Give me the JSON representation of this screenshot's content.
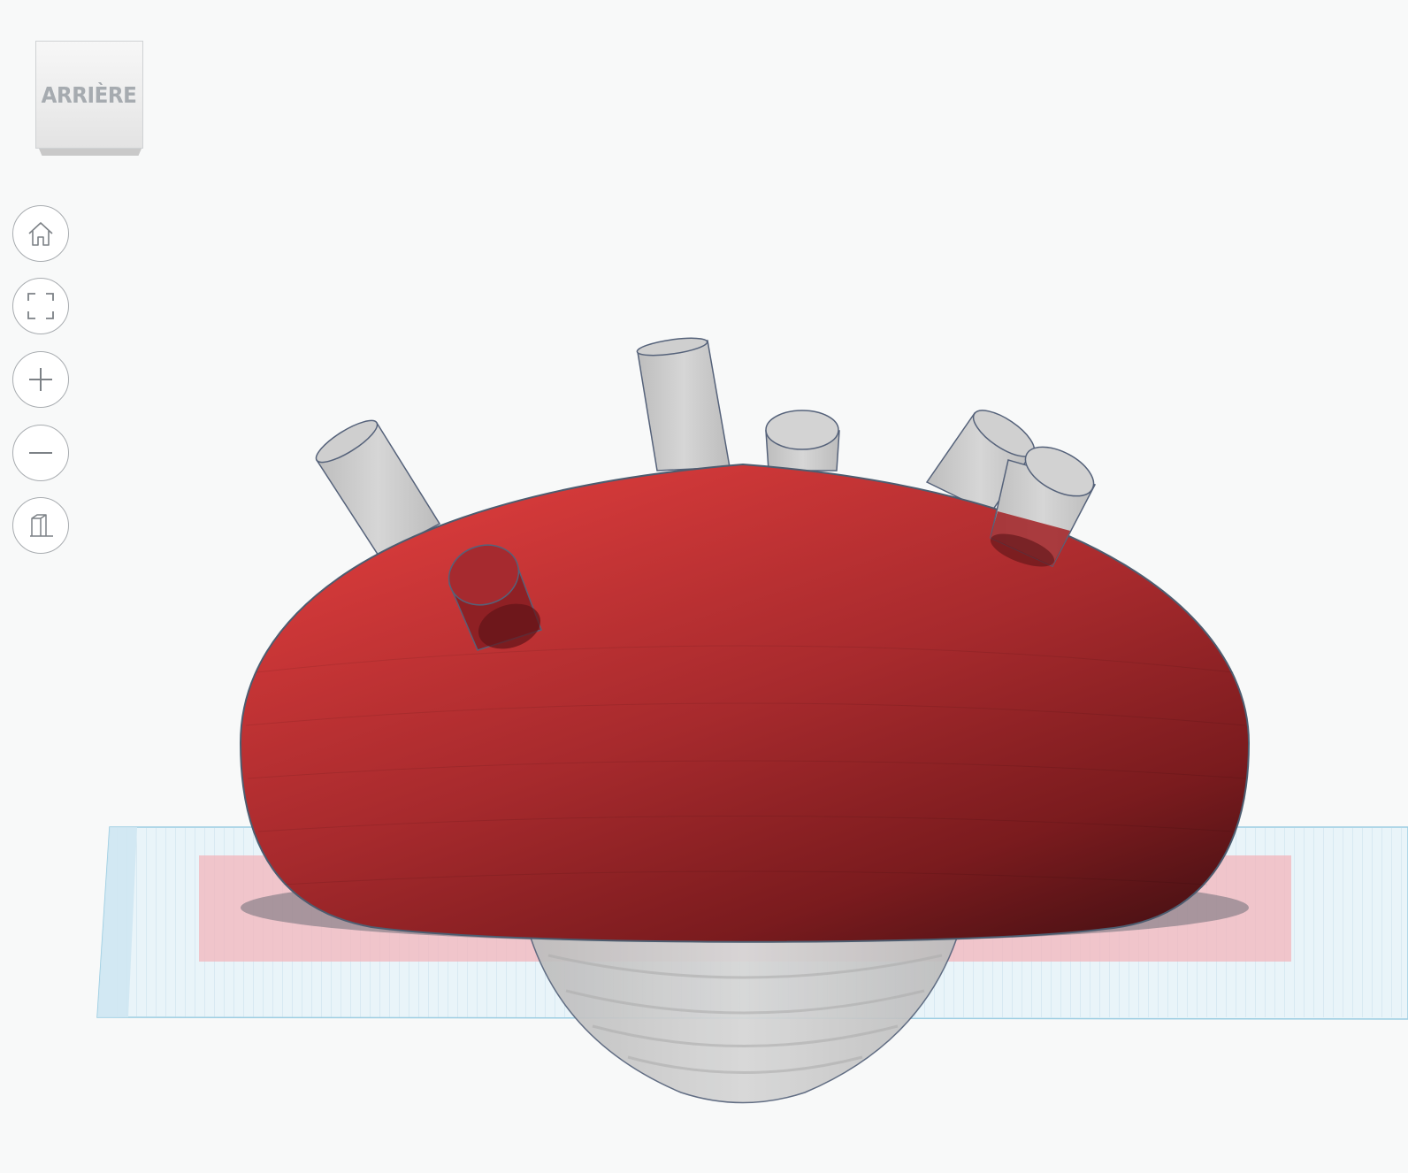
{
  "view_cube": {
    "face_label": "ARRIÈRE"
  },
  "nav_controls": [
    {
      "name": "home-view",
      "icon": "home-icon"
    },
    {
      "name": "fit-all",
      "icon": "fit-view-icon"
    },
    {
      "name": "zoom-in",
      "icon": "plus-icon"
    },
    {
      "name": "zoom-out",
      "icon": "minus-icon"
    },
    {
      "name": "perspective-toggle",
      "icon": "perspective-cube-icon"
    }
  ],
  "scene": {
    "main_shape_color": "#c8262c",
    "hole_shape_color": "#c4c4c4",
    "workplane_color": "#d8ecf4",
    "shadow_color": "#f0b8bc",
    "outline_color": "#4d5d70"
  }
}
